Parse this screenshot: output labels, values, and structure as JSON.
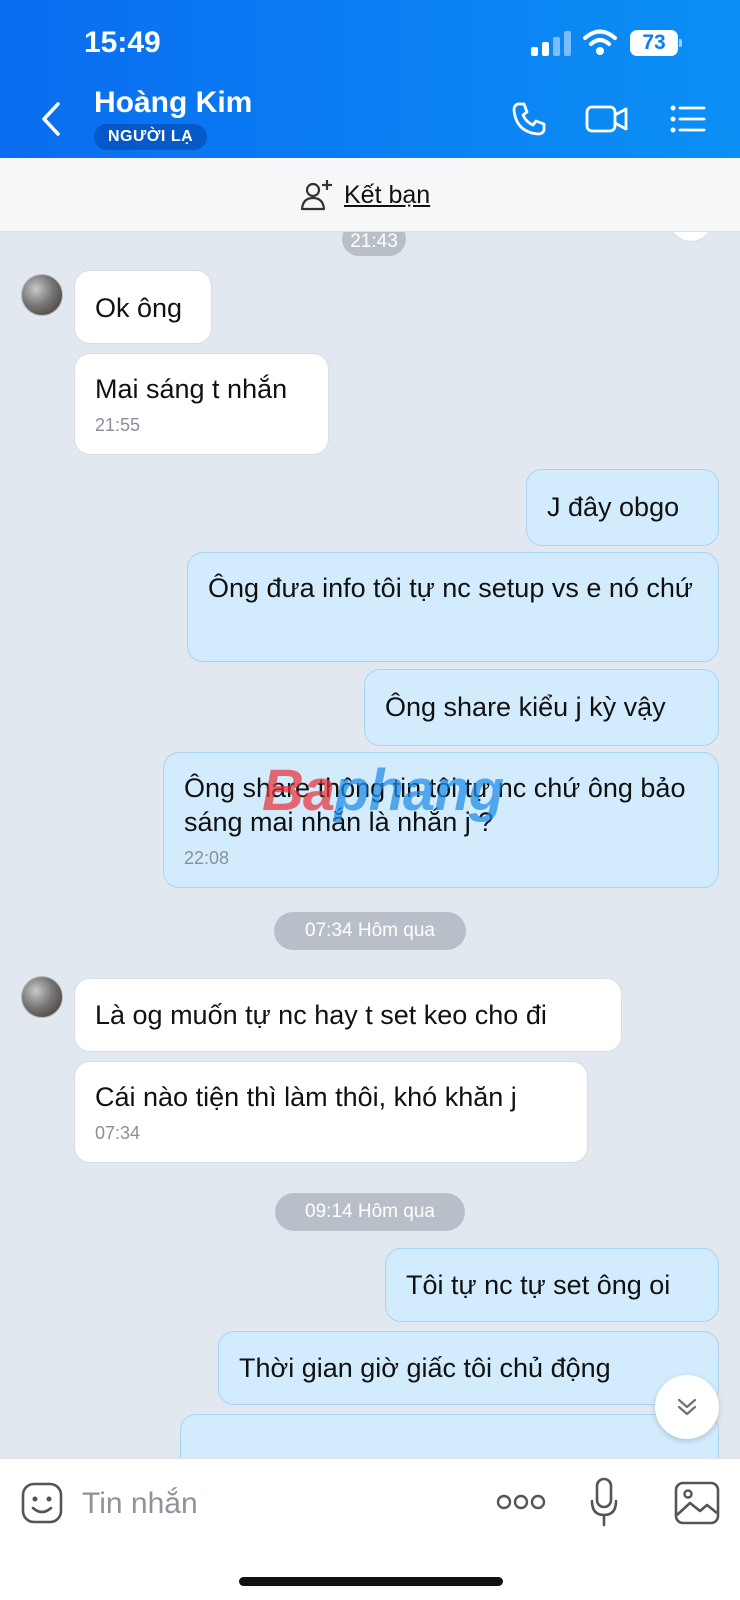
{
  "status_bar": {
    "time": "15:49",
    "battery": "73"
  },
  "header": {
    "contact_name": "Hoàng Kim",
    "badge": "NGƯỜI LẠ"
  },
  "friend_bar": {
    "label": "Kết bạn"
  },
  "watermark": {
    "part1": "Ba",
    "part2": "phang"
  },
  "messages": [
    {
      "text": "Ok ông"
    },
    {
      "text": "Mai sáng t nhắn",
      "time": "21:55"
    },
    {
      "text": "J đây obgo"
    },
    {
      "text": "Ông đưa info tôi tự nc setup vs e nó chứ"
    },
    {
      "text": "Ông share kiểu j kỳ vậy"
    },
    {
      "text": "Ông share thông tin tôi tự nc chứ ông bảo sáng mai nhắn là nhắn j ?",
      "time": "22:08"
    },
    {
      "text": "Là og muốn tự nc hay t set keo cho đi"
    },
    {
      "text": "Cái nào tiện thì làm thôi, khó khăn j",
      "time": "07:34"
    },
    {
      "text": "Tôi tự nc tự set ông oi"
    },
    {
      "text": "Thời gian giờ giấc tôi chủ động"
    }
  ],
  "separators": {
    "top": "21:43",
    "day1": "07:34 Hôm qua",
    "day2": "09:14 Hôm qua"
  },
  "composer": {
    "placeholder": "Tin nhắn"
  }
}
